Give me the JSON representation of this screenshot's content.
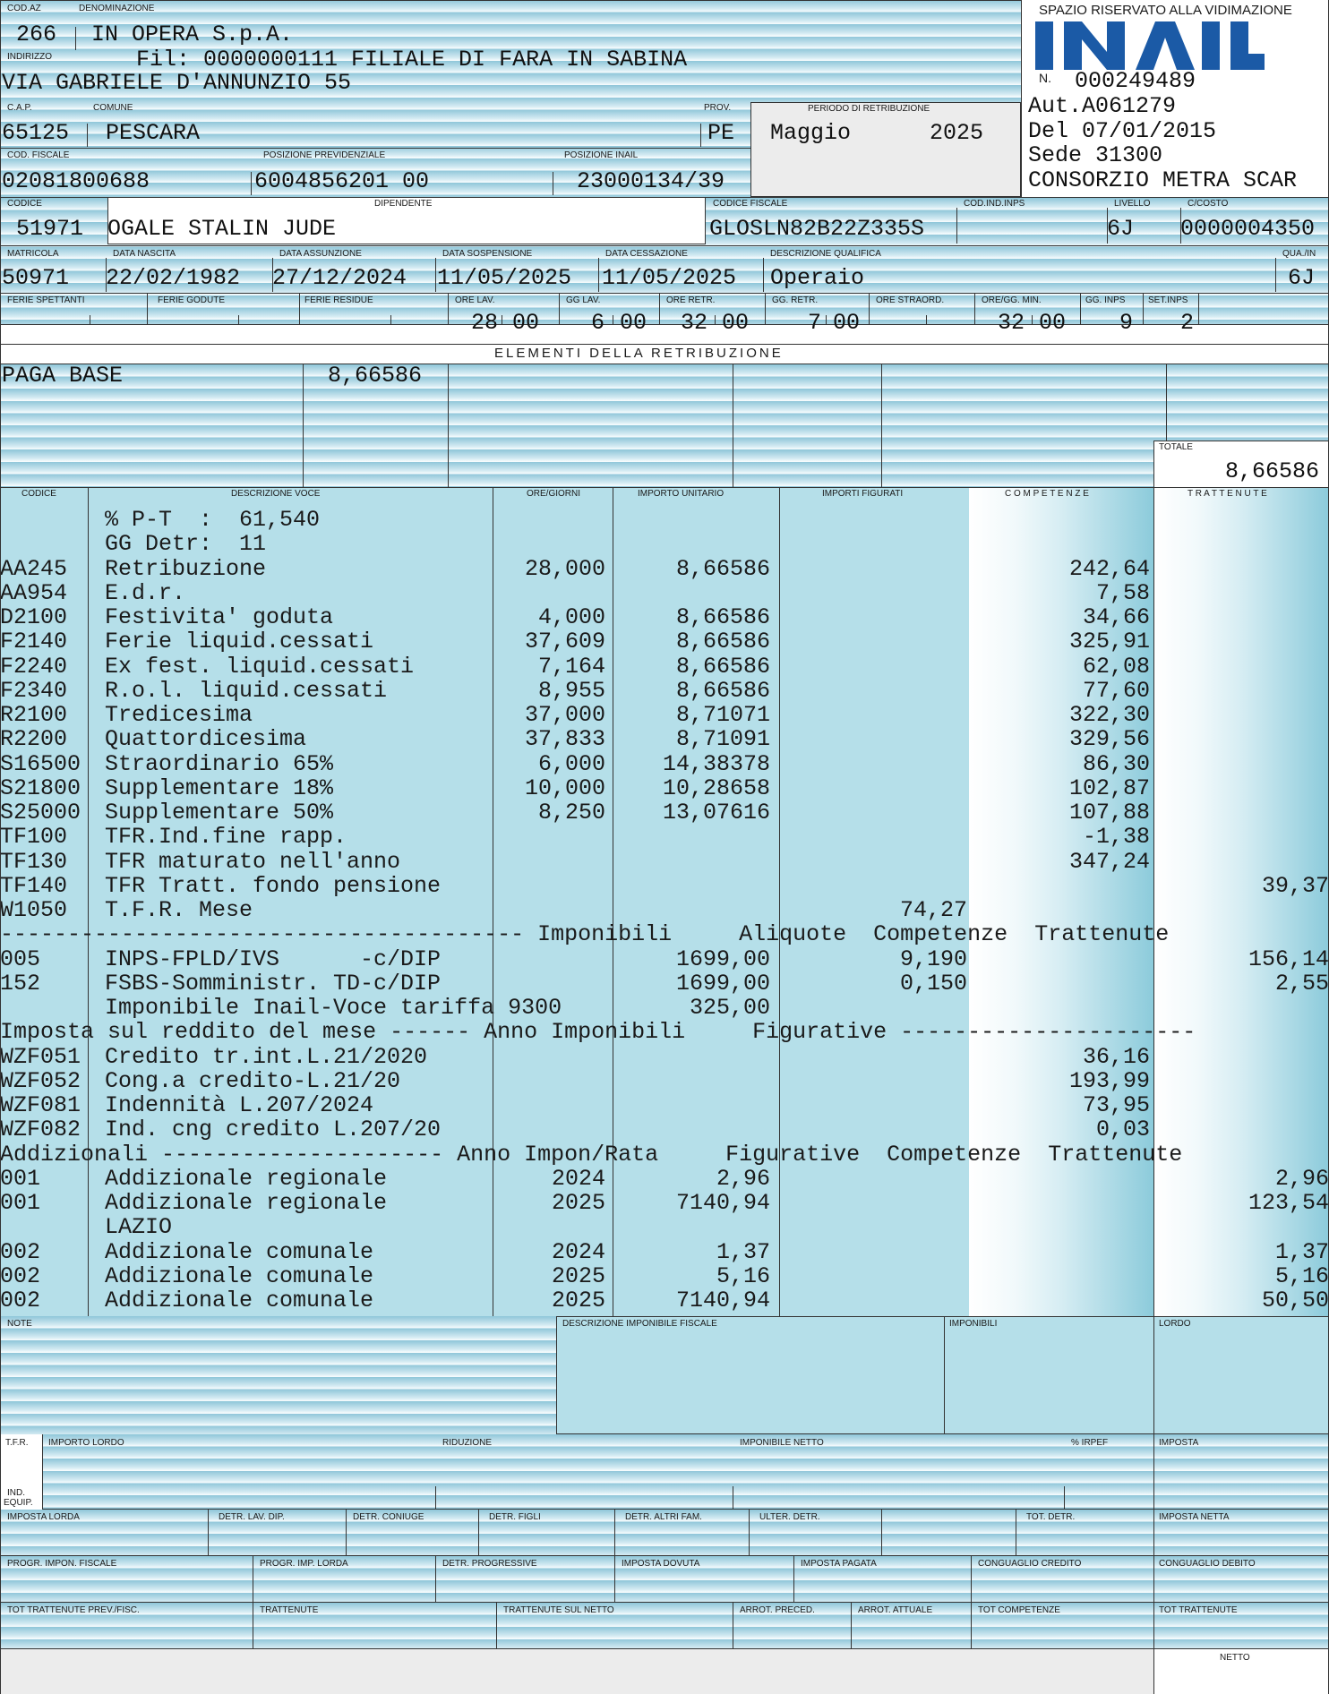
{
  "header": {
    "lbl_codaz": "COD.AZ",
    "lbl_denominazione": "DENOMINAZIONE",
    "cod_az": "266",
    "denominazione": "IN OPERA S.p.A.",
    "lbl_indirizzo": "INDIRIZZO",
    "filiale": "Fil: 0000000111 FILIALE DI FARA IN SABINA",
    "indirizzo": "VIA GABRIELE D'ANNUNZIO 55",
    "lbl_cap": "C.A.P.",
    "lbl_comune": "COMUNE",
    "lbl_prov": "PROV.",
    "cap": "65125",
    "comune": "PESCARA",
    "prov": "PE",
    "lbl_periodo": "PERIODO DI RETRIBUZIONE",
    "periodo_mese": "Maggio",
    "periodo_anno": "2025",
    "lbl_codfisc": "COD. FISCALE",
    "lbl_posprev": "POSIZIONE PREVIDENZIALE",
    "lbl_posinail": "POSIZIONE INAIL",
    "cod_fiscale": "02081800688",
    "pos_prev": "6004856201 00",
    "pos_inail": "23000134/39"
  },
  "vidimazione": {
    "title": "SPAZIO RISERVATO ALLA VIDIMAZIONE",
    "logo_text": "INAIL",
    "n_label": "N.",
    "n_value": "000249489",
    "aut": "Aut.A061279",
    "del": "Del 07/01/2015",
    "sede": "Sede 31300",
    "consorzio": "CONSORZIO METRA SCAR"
  },
  "employee": {
    "lbl_codice": "CODICE",
    "lbl_dipendente": "DIPENDENTE",
    "lbl_codfisc": "CODICE FISCALE",
    "lbl_codinps": "COD.IND.INPS",
    "lbl_livello": "LIVELLO",
    "lbl_ccosto": "C/COSTO",
    "codice": "51971",
    "dipendente": "OGALE STALIN JUDE",
    "codice_fiscale": "GLOSLN82B22Z335S",
    "livello": "6J",
    "ccosto": "0000004350",
    "lbl_matricola": "MATRICOLA",
    "lbl_nascita": "DATA NASCITA",
    "lbl_assunzione": "DATA ASSUNZIONE",
    "lbl_sospensione": "DATA SOSPENSIONE",
    "lbl_cessazione": "DATA CESSAZIONE",
    "lbl_qualifica": "DESCRIZIONE QUALIFICA",
    "lbl_qua": "QUA./IN",
    "matricola": "50971",
    "data_nascita": "22/02/1982",
    "data_assunzione": "27/12/2024",
    "data_sospensione": "11/05/2025",
    "data_cessazione": "11/05/2025",
    "qualifica": "Operaio",
    "qua": "6J"
  },
  "hours": {
    "labels": [
      "FERIE SPETTANTI",
      "FERIE GODUTE",
      "FERIE RESIDUE",
      "ORE LAV.",
      "GG LAV.",
      "ORE RETR.",
      "GG. RETR.",
      "ORE STRAORD.",
      "ORE/GG. MIN.",
      "GG. INPS",
      "SET.INPS"
    ],
    "ore_lav": "28",
    "ore_lav_dec": "00",
    "gg_lav": "6",
    "gg_lav_dec": "00",
    "ore_retr": "32",
    "ore_retr_dec": "00",
    "gg_retr": "7",
    "gg_retr_dec": "00",
    "ore_gg_min": "32",
    "ore_gg_min_dec": "00",
    "gg_inps": "9",
    "set_inps": "2"
  },
  "elementi": {
    "title": "ELEMENTI DELLA RETRIBUZIONE",
    "voce": "PAGA BASE",
    "valore": "8,66586",
    "lbl_totale": "TOTALE",
    "totale": "8,66586"
  },
  "columns": {
    "codice": "CODICE",
    "descrizione": "DESCRIZIONE VOCE",
    "ore_giorni": "ORE/GIORNI",
    "importo_unitario": "IMPORTO UNITARIO",
    "importi_figurati": "IMPORTI FIGURATI",
    "competenze": "C O M P E T E N Z E",
    "trattenute": "T R A T T E N U T E"
  },
  "rows": [
    {
      "t": "line",
      "cod": "",
      "desc": "% P-T  :  61,540"
    },
    {
      "t": "line",
      "cod": "",
      "desc": "GG Detr:  11"
    },
    {
      "t": "v",
      "cod": "AA245",
      "desc": "Retribuzione",
      "ore": "28,000",
      "imp": "8,66586",
      "fig": "",
      "comp": "242,64",
      "tratt": ""
    },
    {
      "t": "v",
      "cod": "AA954",
      "desc": "E.d.r.",
      "ore": "",
      "imp": "",
      "fig": "",
      "comp": "7,58",
      "tratt": ""
    },
    {
      "t": "v",
      "cod": "D2100",
      "desc": "Festivita' goduta",
      "ore": "4,000",
      "imp": "8,66586",
      "fig": "",
      "comp": "34,66",
      "tratt": ""
    },
    {
      "t": "v",
      "cod": "F2140",
      "desc": "Ferie liquid.cessati",
      "ore": "37,609",
      "imp": "8,66586",
      "fig": "",
      "comp": "325,91",
      "tratt": ""
    },
    {
      "t": "v",
      "cod": "F2240",
      "desc": "Ex fest. liquid.cessati",
      "ore": "7,164",
      "imp": "8,66586",
      "fig": "",
      "comp": "62,08",
      "tratt": ""
    },
    {
      "t": "v",
      "cod": "F2340",
      "desc": "R.o.l. liquid.cessati",
      "ore": "8,955",
      "imp": "8,66586",
      "fig": "",
      "comp": "77,60",
      "tratt": ""
    },
    {
      "t": "v",
      "cod": "R2100",
      "desc": "Tredicesima",
      "ore": "37,000",
      "imp": "8,71071",
      "fig": "",
      "comp": "322,30",
      "tratt": ""
    },
    {
      "t": "v",
      "cod": "R2200",
      "desc": "Quattordicesima",
      "ore": "37,833",
      "imp": "8,71091",
      "fig": "",
      "comp": "329,56",
      "tratt": ""
    },
    {
      "t": "v",
      "cod": "S16500",
      "desc": "Straordinario 65%",
      "ore": "6,000",
      "imp": "14,38378",
      "fig": "",
      "comp": "86,30",
      "tratt": ""
    },
    {
      "t": "v",
      "cod": "S21800",
      "desc": "Supplementare 18%",
      "ore": "10,000",
      "imp": "10,28658",
      "fig": "",
      "comp": "102,87",
      "tratt": ""
    },
    {
      "t": "v",
      "cod": "S25000",
      "desc": "Supplementare 50%",
      "ore": "8,250",
      "imp": "13,07616",
      "fig": "",
      "comp": "107,88",
      "tratt": ""
    },
    {
      "t": "v",
      "cod": "TF100",
      "desc": "TFR.Ind.fine rapp.",
      "ore": "",
      "imp": "",
      "fig": "",
      "comp": "-1,38",
      "tratt": ""
    },
    {
      "t": "v",
      "cod": "TF130",
      "desc": "TFR maturato nell'anno",
      "ore": "",
      "imp": "",
      "fig": "",
      "comp": "347,24",
      "tratt": ""
    },
    {
      "t": "v",
      "cod": "TF140",
      "desc": "TFR Tratt. fondo pensione",
      "ore": "",
      "imp": "",
      "fig": "",
      "comp": "",
      "tratt": "39,37"
    },
    {
      "t": "v",
      "cod": "W1050",
      "desc": "T.F.R. Mese",
      "ore": "",
      "imp": "",
      "fig": "74,27",
      "comp": "",
      "tratt": ""
    },
    {
      "t": "line",
      "cod": "",
      "desc": "--------------------------------------- Imponibili     Aliquote  Competenze  Trattenute"
    },
    {
      "t": "v",
      "cod": "005",
      "desc": "INPS-FPLD/IVS      -c/DIP",
      "ore": "",
      "imp": "1699,00",
      "fig": "9,190",
      "comp": "",
      "tratt": "156,14"
    },
    {
      "t": "v",
      "cod": "152",
      "desc": "FSBS-Somministr. TD-c/DIP",
      "ore": "",
      "imp": "1699,00",
      "fig": "0,150",
      "comp": "",
      "tratt": "2,55"
    },
    {
      "t": "v",
      "cod": "",
      "desc": "Imponibile Inail-Voce tariffa 9300",
      "ore": "",
      "imp": "325,00",
      "fig": "",
      "comp": "",
      "tratt": ""
    },
    {
      "t": "line",
      "cod": "",
      "desc": "Imposta sul reddito del mese ------ Anno Imponibili     Figurative ----------------------"
    },
    {
      "t": "v",
      "cod": "WZF051",
      "desc": "Credito tr.int.L.21/2020",
      "ore": "",
      "imp": "",
      "fig": "",
      "comp": "36,16",
      "tratt": ""
    },
    {
      "t": "v",
      "cod": "WZF052",
      "desc": "Cong.a credito-L.21/20",
      "ore": "",
      "imp": "",
      "fig": "",
      "comp": "193,99",
      "tratt": ""
    },
    {
      "t": "v",
      "cod": "WZF081",
      "desc": "Indennità L.207/2024",
      "ore": "",
      "imp": "",
      "fig": "",
      "comp": "73,95",
      "tratt": ""
    },
    {
      "t": "v",
      "cod": "WZF082",
      "desc": "Ind. cng credito L.207/20",
      "ore": "",
      "imp": "",
      "fig": "",
      "comp": "0,03",
      "tratt": ""
    },
    {
      "t": "line",
      "cod": "",
      "desc": "Addizionali --------------------- Anno Impon/Rata     Figurative  Competenze  Trattenute"
    },
    {
      "t": "v",
      "cod": "001",
      "desc": "Addizionale regionale",
      "ore": "2024",
      "imp": "2,96",
      "fig": "",
      "comp": "",
      "tratt": "2,96"
    },
    {
      "t": "v",
      "cod": "001",
      "desc": "Addizionale regionale",
      "ore": "2025",
      "imp": "7140,94",
      "fig": "",
      "comp": "",
      "tratt": "123,54"
    },
    {
      "t": "v",
      "cod": "",
      "desc": "LAZIO",
      "ore": "",
      "imp": "",
      "fig": "",
      "comp": "",
      "tratt": ""
    },
    {
      "t": "v",
      "cod": "002",
      "desc": "Addizionale comunale",
      "ore": "2024",
      "imp": "1,37",
      "fig": "",
      "comp": "",
      "tratt": "1,37"
    },
    {
      "t": "v",
      "cod": "002",
      "desc": "Addizionale comunale",
      "ore": "2025",
      "imp": "5,16",
      "fig": "",
      "comp": "",
      "tratt": "5,16"
    },
    {
      "t": "v",
      "cod": "002",
      "desc": "Addizionale comunale",
      "ore": "2025",
      "imp": "7140,94",
      "fig": "",
      "comp": "",
      "tratt": "50,50"
    }
  ],
  "footer": {
    "note": "NOTE",
    "desc_imponibile": "DESCRIZIONE IMPONIBILE FISCALE",
    "imponibili": "IMPONIBILI",
    "lordo": "LORDO",
    "tfr": "T.F.R.",
    "importo_lordo": "IMPORTO LORDO",
    "riduzione": "RIDUZIONE",
    "imponibile_netto": "IMPONIBILE NETTO",
    "perc_irpef": "% IRPEF",
    "imposta": "IMPOSTA",
    "ind_equip_1": "IND.",
    "ind_equip_2": "EQUIP.",
    "row3": [
      "IMPOSTA LORDA",
      "DETR. LAV. DIP.",
      "DETR. CONIUGE",
      "DETR. FIGLI",
      "DETR. ALTRI FAM.",
      "ULTER. DETR.",
      "",
      "TOT. DETR.",
      "IMPOSTA NETTA"
    ],
    "row4": [
      "PROGR. IMPON. FISCALE",
      "PROGR. IMP. LORDA",
      "DETR. PROGRESSIVE",
      "IMPOSTA DOVUTA",
      "IMPOSTA PAGATA",
      "CONGUAGLIO CREDITO",
      "CONGUAGLIO DEBITO"
    ],
    "row5": [
      "TOT TRATTENUTE PREV./FISC.",
      "TRATTENUTE",
      "TRATTENUTE SUL NETTO",
      "ARROT. PRECED.",
      "ARROT. ATTUALE",
      "TOT COMPETENZE",
      "TOT TRATTENUTE"
    ],
    "netto": "NETTO"
  }
}
